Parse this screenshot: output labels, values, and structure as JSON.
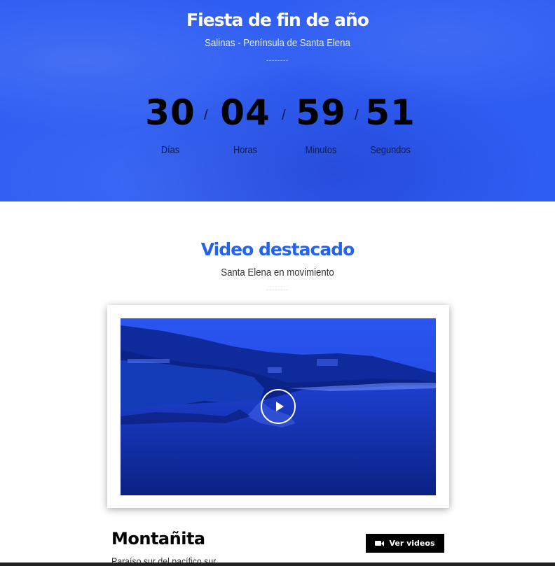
{
  "hero": {
    "title": "Fiesta de fin de año",
    "subtitle": "Salinas - Península de Santa Elena",
    "divider": "--------",
    "background_color": "#2f5ef2"
  },
  "countdown": {
    "separator": "/",
    "units": [
      {
        "value": "30",
        "label": "Días"
      },
      {
        "value": "04",
        "label": "Horas"
      },
      {
        "value": "59",
        "label": "Minutos"
      },
      {
        "value": "51",
        "label": "Segundos"
      }
    ]
  },
  "featured": {
    "title": "Video destacado",
    "subtitle": "Santa Elena en movimiento",
    "divider": "--------",
    "title_color": "#2563eb",
    "play_icon": "play-icon"
  },
  "card": {
    "title": "Montañita",
    "subtitle": "Paraíso sur del pacífico sur",
    "button_label": "Ver videos",
    "button_icon": "video-camera-icon"
  }
}
